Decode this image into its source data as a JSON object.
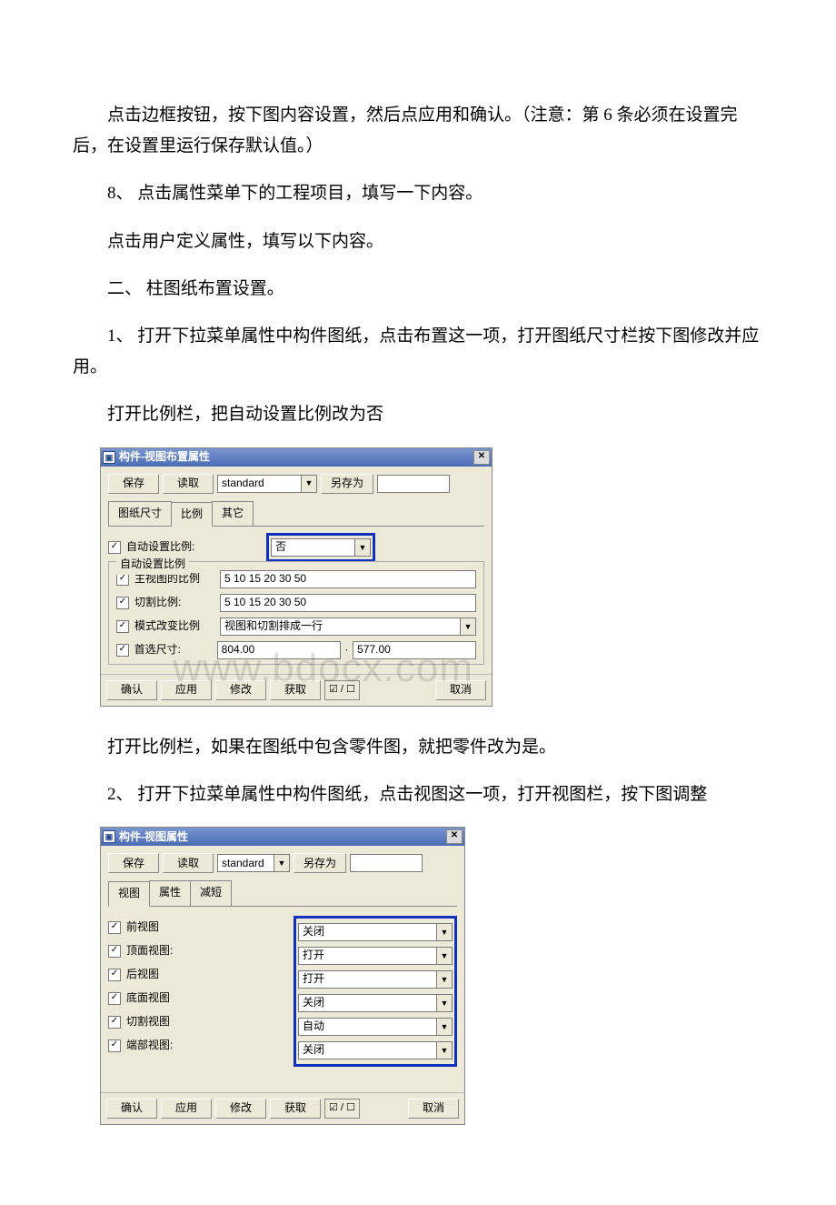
{
  "paragraphs": {
    "p1": "点击边框按钮，按下图内容设置，然后点应用和确认。（注意：第 6 条必须在设置完后，在设置里运行保存默认值。）",
    "p2": "8、 点击属性菜单下的工程项目，填写一下内容。",
    "p3": "点击用户定义属性，填写以下内容。",
    "p4": "二、 柱图纸布置设置。",
    "p5": "1、 打开下拉菜单属性中构件图纸，点击布置这一项，打开图纸尺寸栏按下图修改并应用。",
    "p6": "打开比例栏，把自动设置比例改为否",
    "p7": "打开比例栏，如果在图纸中包含零件图，就把零件改为是。",
    "p8": "2、 打开下拉菜单属性中构件图纸，点击视图这一项，打开视图栏，按下图调整"
  },
  "dlg1": {
    "title": "构件-视图布置属性",
    "buttons": {
      "save": "保存",
      "load": "读取",
      "saveAs": "另存为"
    },
    "preset": "standard",
    "tabs": [
      "图纸尺寸",
      "比例",
      "其它"
    ],
    "activeTab": 1,
    "autoScale": {
      "label": "自动设置比例:",
      "value": "否"
    },
    "group": {
      "legend": "自动设置比例",
      "mainScale": {
        "label": "主视图的比例",
        "value": "5 10 15 20 30 50"
      },
      "cutScale": {
        "label": "切割比例:",
        "value": "5 10 15 20 30 50"
      },
      "modeScale": {
        "label": "模式改变比例",
        "value": "视图和切割排成一行"
      },
      "prefSize": {
        "label": "首选尺寸:",
        "w": "804.00",
        "h": "577.00"
      }
    },
    "footer": {
      "ok": "确认",
      "apply": "应用",
      "modify": "修改",
      "get": "获取",
      "cancel": "取消"
    }
  },
  "dlg2": {
    "title": "构件-视图属性",
    "buttons": {
      "save": "保存",
      "load": "读取",
      "saveAs": "另存为"
    },
    "preset": "standard",
    "tabs": [
      "视图",
      "属性",
      "减短"
    ],
    "activeTab": 0,
    "rows": [
      {
        "label": "前视图",
        "value": "关闭"
      },
      {
        "label": "顶面视图:",
        "value": "打开"
      },
      {
        "label": "后视图",
        "value": "打开"
      },
      {
        "label": "底面视图",
        "value": "关闭"
      },
      {
        "label": "切割视图",
        "value": "自动"
      },
      {
        "label": "端部视图:",
        "value": "关闭"
      }
    ],
    "footer": {
      "ok": "确认",
      "apply": "应用",
      "modify": "修改",
      "get": "获取",
      "cancel": "取消"
    }
  },
  "watermark": "www.bdocx.com"
}
